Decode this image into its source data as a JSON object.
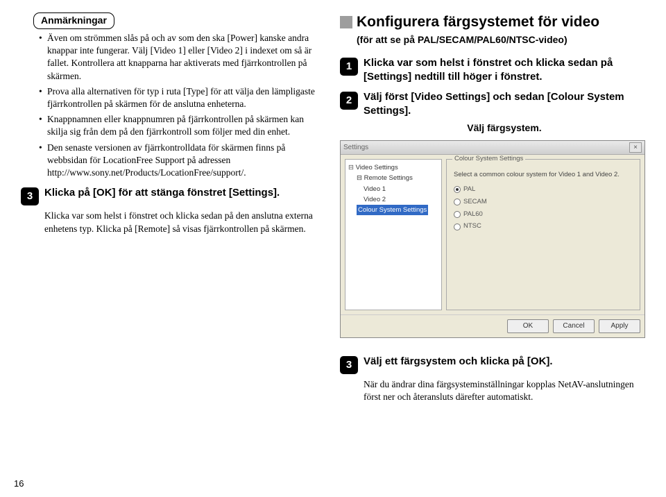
{
  "left": {
    "note_label": "Anmärkningar",
    "bullets": [
      "Även om strömmen slås på och av som den ska [Power] kanske andra knappar inte fungerar. Välj [Video 1] eller [Video 2] i indexet om så är fallet. Kontrollera att knapparna har aktiverats med fjärrkontrollen på skärmen.",
      "Prova alla alternativen för typ i ruta [Type] för att välja den lämpligaste fjärrkontrollen på skärmen för de anslutna enheterna.",
      "Knappnamnen eller knappnumren på fjärrkontrollen på skärmen kan skilja sig från dem på den fjärrkontroll som följer med din enhet.",
      "Den senaste versionen av fjärrkontrolldata för skärmen finns på webbsidan för LocationFree Support på adressen http://www.sony.net/Products/LocationFree/support/."
    ],
    "step3_num": "3",
    "step3": "Klicka på [OK] för att stänga fönstret [Settings].",
    "step3_after": "Klicka var som helst i fönstret och klicka sedan på den anslutna externa enhetens typ. Klicka på [Remote] så visas fjärrkontrollen på skärmen."
  },
  "right": {
    "heading": "Konfigurera färgsystemet för video",
    "subheading": "(för att se på PAL/SECAM/PAL60/NTSC-video)",
    "step1_num": "1",
    "step1": "Klicka var som helst i fönstret och klicka sedan på [Settings] nedtill till höger i fönstret.",
    "step2_num": "2",
    "step2": "Välj först [Video Settings] och sedan [Colour System Settings].",
    "step2_after": "Välj färgsystem.",
    "win": {
      "title": "Settings",
      "tree_root": "Video Settings",
      "tree_remote": "Remote Settings",
      "tree_v1": "Video 1",
      "tree_v2": "Video 2",
      "tree_colour": "Colour System Settings",
      "group_label": "Colour System Settings",
      "group_desc": "Select a common colour system for Video 1 and Video 2.",
      "radios": [
        "PAL",
        "SECAM",
        "PAL60",
        "NTSC"
      ],
      "btn_ok": "OK",
      "btn_cancel": "Cancel",
      "btn_apply": "Apply"
    },
    "step3_num": "3",
    "step3": "Välj ett färgsystem och klicka på [OK].",
    "step3_after": "När du ändrar dina färgsysteminställningar kopplas NetAV-anslutningen först ner och återansluts därefter automatiskt."
  },
  "page_number": "16"
}
